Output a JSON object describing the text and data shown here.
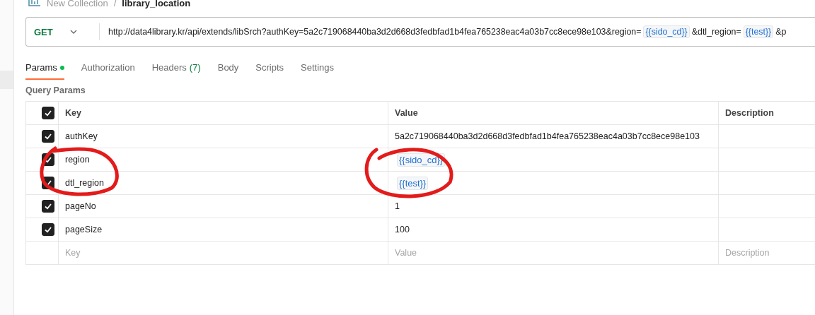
{
  "breadcrumb": {
    "collection": "New Collection",
    "separator": "/",
    "request": "library_location"
  },
  "request": {
    "method": "GET",
    "url": [
      {
        "kind": "text",
        "text": "http://data4library.kr/api/extends/libSrch?authKey=5a2c719068440ba3d2d668d3fedbfad1b4fea765238eac4a03b7cc8ece98e103&region="
      },
      {
        "kind": "variable",
        "text": "{{sido_cd}}"
      },
      {
        "kind": "text",
        "text": "&dtl_region="
      },
      {
        "kind": "variable",
        "text": "{{test}}"
      },
      {
        "kind": "text",
        "text": "&p"
      }
    ]
  },
  "tabs": [
    {
      "label": "Params",
      "selected": true,
      "dot": true
    },
    {
      "label": "Authorization",
      "selected": false,
      "dot": false
    },
    {
      "label": "Headers",
      "count": "(7)",
      "selected": false,
      "dot": false
    },
    {
      "label": "Body",
      "selected": false,
      "dot": false
    },
    {
      "label": "Scripts",
      "selected": false,
      "dot": false
    },
    {
      "label": "Settings",
      "selected": false,
      "dot": false
    }
  ],
  "section_title": "Query Params",
  "table": {
    "header_checked": true,
    "columns": [
      "Key",
      "Value",
      "Description"
    ],
    "rows": [
      {
        "checked": true,
        "key": "authKey",
        "value": {
          "kind": "text",
          "text": "5a2c719068440ba3d2d668d3fedbfad1b4fea765238eac4a03b7cc8ece98e103"
        }
      },
      {
        "checked": true,
        "key": "region",
        "value": {
          "kind": "variable",
          "text": "{{sido_cd}}"
        }
      },
      {
        "checked": true,
        "key": "dtl_region",
        "value": {
          "kind": "variable",
          "text": "{{test}}"
        }
      },
      {
        "checked": true,
        "key": "pageNo",
        "value": {
          "kind": "text",
          "text": "1"
        }
      },
      {
        "checked": true,
        "key": "pageSize",
        "value": {
          "kind": "text",
          "text": "100"
        }
      }
    ],
    "placeholders": {
      "key": "Key",
      "value": "Value",
      "description": "Description"
    }
  }
}
